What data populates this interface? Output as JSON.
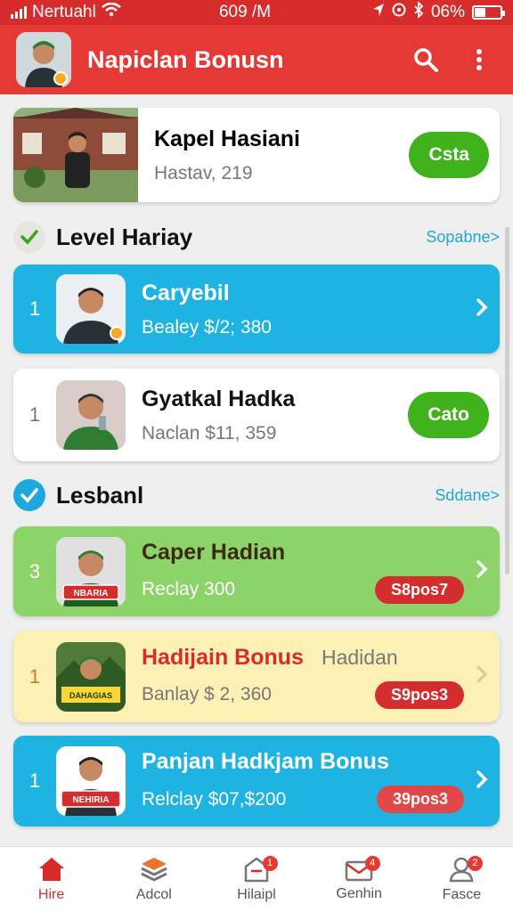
{
  "status": {
    "carrier": "Nertuahl",
    "time": "609 /M",
    "battery": "06%"
  },
  "appbar": {
    "title": "Napiclan Bonusn"
  },
  "featured": {
    "name": "Kapel Hasiani",
    "sub": "Hastav, 219",
    "button": "Csta"
  },
  "section1": {
    "label": "Level Hariay",
    "link": "Sopabne>"
  },
  "section2": {
    "label": "Lesbanl",
    "link": "Sddane>"
  },
  "rows": [
    {
      "rank": "1",
      "name": "Caryebil",
      "sub": "Bealey $/2; 380"
    },
    {
      "rank": "1",
      "name": "Gyatkal Hadka",
      "sub": "Naclan $11, 359",
      "button": "Cato"
    },
    {
      "rank": "3",
      "name": "Caper Hadian",
      "sub": "Reclay 300",
      "tag": "S8pos7",
      "thumb_label": "NBARIA"
    },
    {
      "rank": "1",
      "name": "Hadijain Bonus",
      "extra": "Hadidan",
      "sub": "Banlay $ 2, 360",
      "tag": "S9pos3",
      "thumb_label": "DAHAGIAS"
    },
    {
      "rank": "1",
      "name": "Panjan Hadkjam Bonus",
      "sub": "Relclay $07,$200",
      "tag": "39pos3",
      "thumb_label": "NEHIRIA"
    }
  ],
  "nav": [
    {
      "label": "Hire"
    },
    {
      "label": "Adcol"
    },
    {
      "label": "Hilaipl",
      "badge": "1"
    },
    {
      "label": "Genhin",
      "badge": "4"
    },
    {
      "label": "Fasce",
      "badge": "2"
    }
  ]
}
